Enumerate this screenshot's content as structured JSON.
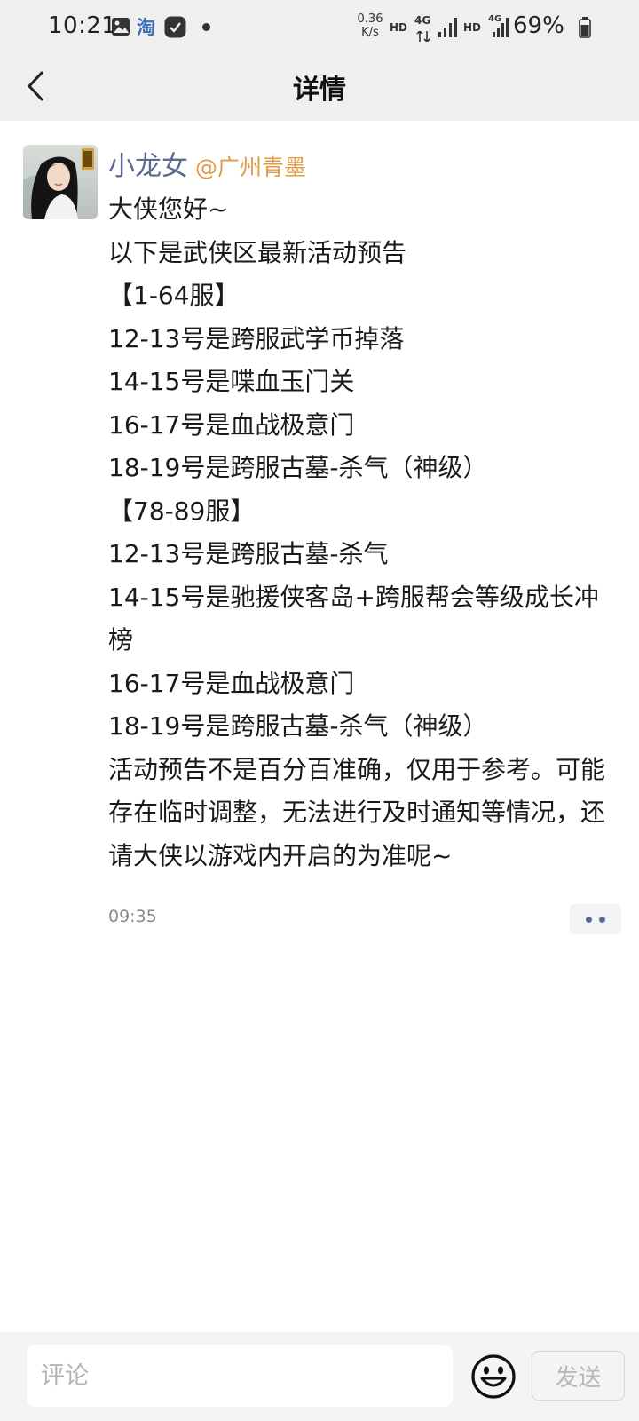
{
  "status_bar": {
    "time": "10:21",
    "speed_value": "0.36",
    "speed_unit": "K/s",
    "hd1": "HD",
    "net1": "4G",
    "hd2": "HD",
    "net2": "4G",
    "battery": "69%",
    "icons": [
      "gallery-icon",
      "taobao-icon",
      "app-icon",
      "notification-dot",
      "signal-icon",
      "battery-icon"
    ]
  },
  "header": {
    "back_icon": "chevron-left-icon",
    "title": "详情"
  },
  "post": {
    "author_name": "小龙女",
    "author_handle": "@广州青墨",
    "lines": [
      "大侠您好~",
      "以下是武侠区最新活动预告",
      "【1-64服】",
      "12-13号是跨服武学币掉落",
      "14-15号是喋血玉门关",
      "16-17号是血战极意门",
      "18-19号是跨服古墓-杀气（神级）",
      "【78-89服】",
      "12-13号是跨服古墓-杀气",
      "14-15号是驰援侠客岛+跨服帮会等级成长冲榜",
      "16-17号是血战极意门",
      "18-19号是跨服古墓-杀气（神级）",
      "活动预告不是百分百准确，仅用于参考。可能存在临时调整，无法进行及时通知等情况，还请大侠以游戏内开启的为准呢~"
    ],
    "time": "09:35",
    "more_icon": "more-dots-icon"
  },
  "comment_bar": {
    "input_placeholder": "评论",
    "emoji_icon": "smiley-icon",
    "send_label": "发送"
  },
  "colors": {
    "header_bg": "#efefef",
    "author_name": "#5b6b8f",
    "author_handle": "#e39a44",
    "time_text": "#8a8a8a"
  }
}
